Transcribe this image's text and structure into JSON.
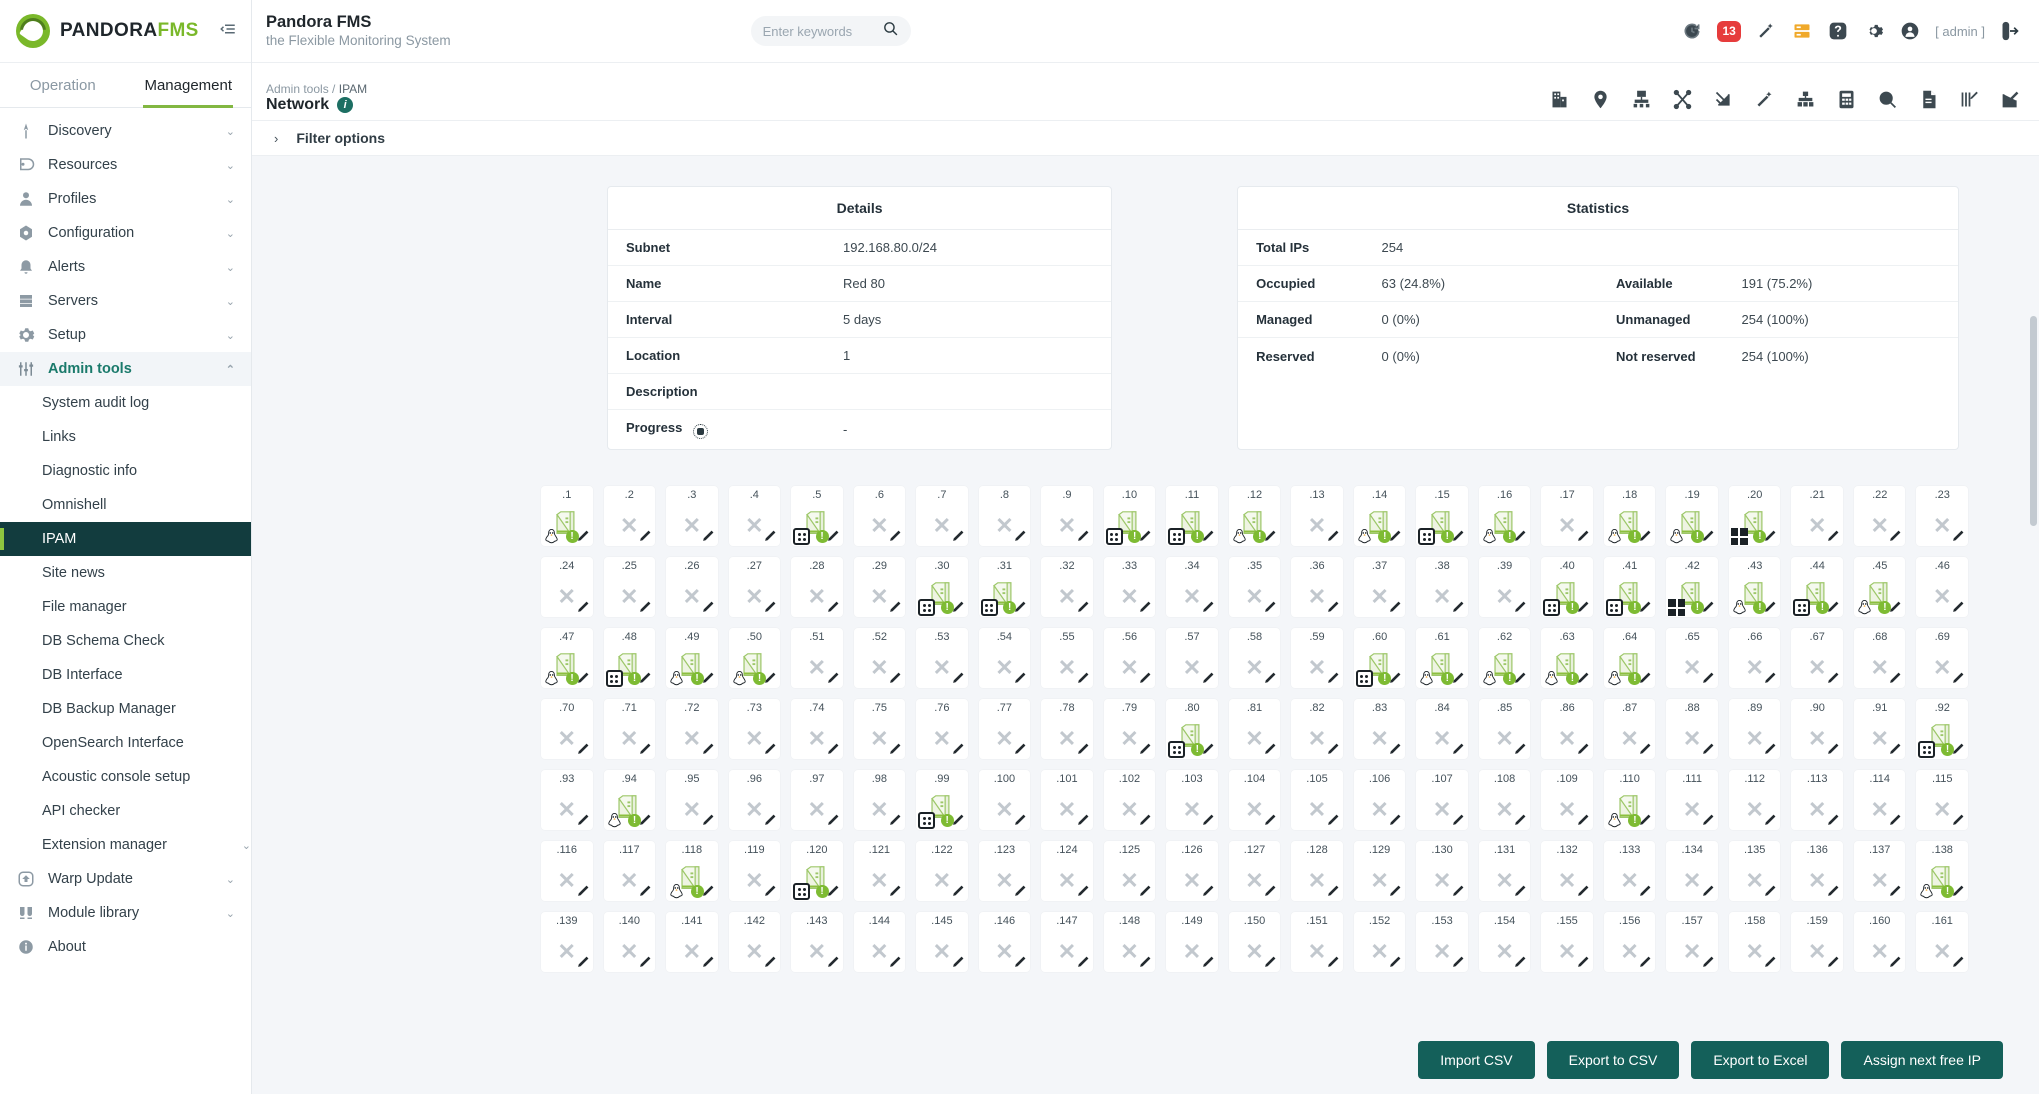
{
  "brand": {
    "name_dark": "PANDORA",
    "name_green": "FMS",
    "collapse_icon": "collapse-icon"
  },
  "tabs": [
    {
      "label": "Operation",
      "active": false
    },
    {
      "label": "Management",
      "active": true
    }
  ],
  "sidebar": {
    "groups": [
      {
        "label": "Discovery",
        "icon": "discovery-icon",
        "chevron": "⌄"
      },
      {
        "label": "Resources",
        "icon": "resources-icon",
        "chevron": "⌄"
      },
      {
        "label": "Profiles",
        "icon": "profiles-icon",
        "chevron": "⌄"
      },
      {
        "label": "Configuration",
        "icon": "configuration-icon",
        "chevron": "⌄"
      },
      {
        "label": "Alerts",
        "icon": "alerts-icon",
        "chevron": "⌄"
      },
      {
        "label": "Servers",
        "icon": "servers-icon",
        "chevron": "⌄"
      },
      {
        "label": "Setup",
        "icon": "setup-icon",
        "chevron": "⌄"
      },
      {
        "label": "Admin tools",
        "icon": "admin-tools-icon",
        "chevron": "⌃",
        "open": true
      }
    ],
    "admin_tools_items": [
      {
        "label": "System audit log",
        "active": false
      },
      {
        "label": "Links",
        "active": false
      },
      {
        "label": "Diagnostic info",
        "active": false
      },
      {
        "label": "Omnishell",
        "active": false
      },
      {
        "label": "IPAM",
        "active": true
      },
      {
        "label": "Site news",
        "active": false
      },
      {
        "label": "File manager",
        "active": false
      },
      {
        "label": "DB Schema Check",
        "active": false
      },
      {
        "label": "DB Interface",
        "active": false
      },
      {
        "label": "DB Backup Manager",
        "active": false
      },
      {
        "label": "OpenSearch Interface",
        "active": false
      },
      {
        "label": "Acoustic console setup",
        "active": false
      },
      {
        "label": "API checker",
        "active": false
      },
      {
        "label": "Extension manager",
        "active": false,
        "chevron": "⌄"
      }
    ],
    "bottom_groups": [
      {
        "label": "Warp Update",
        "icon": "warp-update-icon",
        "chevron": "⌄"
      },
      {
        "label": "Module library",
        "icon": "module-library-icon",
        "chevron": "⌄"
      },
      {
        "label": "About",
        "icon": "about-icon"
      }
    ]
  },
  "header": {
    "title": "Pandora FMS",
    "subtitle": "the Flexible Monitoring System",
    "search_placeholder": "Enter keywords",
    "search_value": "",
    "alert_count": "13",
    "user_label": "[ admin ]",
    "icons": [
      "clock-refresh-icon",
      "alert-badge",
      "wand-icon",
      "servers-status-icon",
      "help-icon",
      "gear-icon",
      "user-avatar-icon",
      "logout-icon"
    ]
  },
  "subheader": {
    "breadcrumb_parent": "Admin tools",
    "breadcrumb_sep": "/",
    "breadcrumb_current": "IPAM",
    "page_title": "Network",
    "info_icon": "info-icon",
    "tool_icons": [
      "building-icon",
      "map-pin-icon",
      "network-map-icon",
      "vlan-icon",
      "supernet-icon",
      "wand-icon",
      "sitemap-icon",
      "calculator-icon",
      "search-icon",
      "report-icon",
      "vlan-wan-icon",
      "edit-icon"
    ]
  },
  "filter": {
    "chevron": "›",
    "label": "Filter options"
  },
  "details": {
    "title": "Details",
    "rows": [
      {
        "key": "Subnet",
        "value": "192.168.80.0/24"
      },
      {
        "key": "Name",
        "value": "Red 80"
      },
      {
        "key": "Interval",
        "value": "5 days"
      },
      {
        "key": "Location",
        "value": "1"
      },
      {
        "key": "Description",
        "value": ""
      },
      {
        "key": "Progress",
        "value": "-",
        "icon": "progress-gear-icon"
      }
    ]
  },
  "statistics": {
    "title": "Statistics",
    "rows": [
      {
        "key": "Total IPs",
        "value": "254",
        "key2": "",
        "value2": ""
      },
      {
        "key": "Occupied",
        "value": "63 (24.8%)",
        "key2": "Available",
        "value2": "191 (75.2%)"
      },
      {
        "key": "Managed",
        "value": "0 (0%)",
        "key2": "Unmanaged",
        "value2": "254 (100%)"
      },
      {
        "key": "Reserved",
        "value": "0 (0%)",
        "key2": "Not reserved",
        "value2": "254 (100%)"
      }
    ]
  },
  "buttons": [
    {
      "label": "Import CSV",
      "name": "import-csv-button"
    },
    {
      "label": "Export to CSV",
      "name": "export-csv-button"
    },
    {
      "label": "Export to Excel",
      "name": "export-excel-button"
    },
    {
      "label": "Assign next free IP",
      "name": "assign-next-free-ip-button"
    }
  ],
  "ip_grid": {
    "columns": 23,
    "cells": [
      {
        "label": ".1",
        "state": "occupied",
        "os": "linux"
      },
      {
        "label": ".2",
        "state": "free"
      },
      {
        "label": ".3",
        "state": "free"
      },
      {
        "label": ".4",
        "state": "free"
      },
      {
        "label": ".5",
        "state": "occupied",
        "os": "box"
      },
      {
        "label": ".6",
        "state": "free"
      },
      {
        "label": ".7",
        "state": "free"
      },
      {
        "label": ".8",
        "state": "free"
      },
      {
        "label": ".9",
        "state": "free"
      },
      {
        "label": ".10",
        "state": "occupied",
        "os": "box"
      },
      {
        "label": ".11",
        "state": "occupied",
        "os": "box"
      },
      {
        "label": ".12",
        "state": "occupied",
        "os": "linux"
      },
      {
        "label": ".13",
        "state": "free"
      },
      {
        "label": ".14",
        "state": "occupied",
        "os": "linux"
      },
      {
        "label": ".15",
        "state": "occupied",
        "os": "box"
      },
      {
        "label": ".16",
        "state": "occupied",
        "os": "linux"
      },
      {
        "label": ".17",
        "state": "free"
      },
      {
        "label": ".18",
        "state": "occupied",
        "os": "linux"
      },
      {
        "label": ".19",
        "state": "occupied",
        "os": "linux"
      },
      {
        "label": ".20",
        "state": "occupied",
        "os": "windows"
      },
      {
        "label": ".21",
        "state": "free"
      },
      {
        "label": ".22",
        "state": "free"
      },
      {
        "label": ".23",
        "state": "free"
      },
      {
        "label": ".24",
        "state": "free"
      },
      {
        "label": ".25",
        "state": "free"
      },
      {
        "label": ".26",
        "state": "free"
      },
      {
        "label": ".27",
        "state": "free"
      },
      {
        "label": ".28",
        "state": "free"
      },
      {
        "label": ".29",
        "state": "free"
      },
      {
        "label": ".30",
        "state": "occupied",
        "os": "box"
      },
      {
        "label": ".31",
        "state": "occupied",
        "os": "box"
      },
      {
        "label": ".32",
        "state": "free"
      },
      {
        "label": ".33",
        "state": "free"
      },
      {
        "label": ".34",
        "state": "free"
      },
      {
        "label": ".35",
        "state": "free"
      },
      {
        "label": ".36",
        "state": "free"
      },
      {
        "label": ".37",
        "state": "free"
      },
      {
        "label": ".38",
        "state": "free"
      },
      {
        "label": ".39",
        "state": "free"
      },
      {
        "label": ".40",
        "state": "occupied",
        "os": "box"
      },
      {
        "label": ".41",
        "state": "occupied",
        "os": "box"
      },
      {
        "label": ".42",
        "state": "occupied",
        "os": "windows"
      },
      {
        "label": ".43",
        "state": "occupied",
        "os": "linux"
      },
      {
        "label": ".44",
        "state": "occupied",
        "os": "box"
      },
      {
        "label": ".45",
        "state": "occupied",
        "os": "linux"
      },
      {
        "label": ".46",
        "state": "free"
      },
      {
        "label": ".47",
        "state": "occupied",
        "os": "linux"
      },
      {
        "label": ".48",
        "state": "occupied",
        "os": "box"
      },
      {
        "label": ".49",
        "state": "occupied",
        "os": "linux"
      },
      {
        "label": ".50",
        "state": "occupied",
        "os": "linux"
      },
      {
        "label": ".51",
        "state": "free"
      },
      {
        "label": ".52",
        "state": "free"
      },
      {
        "label": ".53",
        "state": "free"
      },
      {
        "label": ".54",
        "state": "free"
      },
      {
        "label": ".55",
        "state": "free"
      },
      {
        "label": ".56",
        "state": "free"
      },
      {
        "label": ".57",
        "state": "free"
      },
      {
        "label": ".58",
        "state": "free"
      },
      {
        "label": ".59",
        "state": "free"
      },
      {
        "label": ".60",
        "state": "occupied",
        "os": "box"
      },
      {
        "label": ".61",
        "state": "occupied",
        "os": "linux"
      },
      {
        "label": ".62",
        "state": "occupied",
        "os": "linux"
      },
      {
        "label": ".63",
        "state": "occupied",
        "os": "linux"
      },
      {
        "label": ".64",
        "state": "occupied",
        "os": "linux"
      },
      {
        "label": ".65",
        "state": "free"
      },
      {
        "label": ".66",
        "state": "free"
      },
      {
        "label": ".67",
        "state": "free"
      },
      {
        "label": ".68",
        "state": "free"
      },
      {
        "label": ".69",
        "state": "free"
      },
      {
        "label": ".70",
        "state": "free"
      },
      {
        "label": ".71",
        "state": "free"
      },
      {
        "label": ".72",
        "state": "free"
      },
      {
        "label": ".73",
        "state": "free"
      },
      {
        "label": ".74",
        "state": "free"
      },
      {
        "label": ".75",
        "state": "free"
      },
      {
        "label": ".76",
        "state": "free"
      },
      {
        "label": ".77",
        "state": "free"
      },
      {
        "label": ".78",
        "state": "free"
      },
      {
        "label": ".79",
        "state": "free"
      },
      {
        "label": ".80",
        "state": "occupied",
        "os": "box"
      },
      {
        "label": ".81",
        "state": "free"
      },
      {
        "label": ".82",
        "state": "free"
      },
      {
        "label": ".83",
        "state": "free"
      },
      {
        "label": ".84",
        "state": "free"
      },
      {
        "label": ".85",
        "state": "free"
      },
      {
        "label": ".86",
        "state": "free"
      },
      {
        "label": ".87",
        "state": "free"
      },
      {
        "label": ".88",
        "state": "free"
      },
      {
        "label": ".89",
        "state": "free"
      },
      {
        "label": ".90",
        "state": "free"
      },
      {
        "label": ".91",
        "state": "free"
      },
      {
        "label": ".92",
        "state": "occupied",
        "os": "box"
      },
      {
        "label": ".93",
        "state": "free"
      },
      {
        "label": ".94",
        "state": "occupied",
        "os": "linux"
      },
      {
        "label": ".95",
        "state": "free"
      },
      {
        "label": ".96",
        "state": "free"
      },
      {
        "label": ".97",
        "state": "free"
      },
      {
        "label": ".98",
        "state": "free"
      },
      {
        "label": ".99",
        "state": "occupied",
        "os": "box"
      },
      {
        "label": ".100",
        "state": "free"
      },
      {
        "label": ".101",
        "state": "free"
      },
      {
        "label": ".102",
        "state": "free"
      },
      {
        "label": ".103",
        "state": "free"
      },
      {
        "label": ".104",
        "state": "free"
      },
      {
        "label": ".105",
        "state": "free"
      },
      {
        "label": ".106",
        "state": "free"
      },
      {
        "label": ".107",
        "state": "free"
      },
      {
        "label": ".108",
        "state": "free"
      },
      {
        "label": ".109",
        "state": "free"
      },
      {
        "label": ".110",
        "state": "occupied",
        "os": "linux"
      },
      {
        "label": ".111",
        "state": "free"
      },
      {
        "label": ".112",
        "state": "free"
      },
      {
        "label": ".113",
        "state": "free"
      },
      {
        "label": ".114",
        "state": "free"
      },
      {
        "label": ".115",
        "state": "free"
      },
      {
        "label": ".116",
        "state": "free"
      },
      {
        "label": ".117",
        "state": "free"
      },
      {
        "label": ".118",
        "state": "occupied",
        "os": "linux"
      },
      {
        "label": ".119",
        "state": "free"
      },
      {
        "label": ".120",
        "state": "occupied",
        "os": "box"
      },
      {
        "label": ".121",
        "state": "free"
      },
      {
        "label": ".122",
        "state": "free"
      },
      {
        "label": ".123",
        "state": "free"
      },
      {
        "label": ".124",
        "state": "free"
      },
      {
        "label": ".125",
        "state": "free"
      },
      {
        "label": ".126",
        "state": "free"
      },
      {
        "label": ".127",
        "state": "free"
      },
      {
        "label": ".128",
        "state": "free"
      },
      {
        "label": ".129",
        "state": "free"
      },
      {
        "label": ".130",
        "state": "free"
      },
      {
        "label": ".131",
        "state": "free"
      },
      {
        "label": ".132",
        "state": "free"
      },
      {
        "label": ".133",
        "state": "free"
      },
      {
        "label": ".134",
        "state": "free"
      },
      {
        "label": ".135",
        "state": "free"
      },
      {
        "label": ".136",
        "state": "free"
      },
      {
        "label": ".137",
        "state": "free"
      },
      {
        "label": ".138",
        "state": "occupied",
        "os": "linux"
      },
      {
        "label": ".139",
        "state": "free"
      },
      {
        "label": ".140",
        "state": "free"
      },
      {
        "label": ".141",
        "state": "free"
      },
      {
        "label": ".142",
        "state": "free"
      },
      {
        "label": ".143",
        "state": "free"
      },
      {
        "label": ".144",
        "state": "free"
      },
      {
        "label": ".145",
        "state": "free"
      },
      {
        "label": ".146",
        "state": "free"
      },
      {
        "label": ".147",
        "state": "free"
      },
      {
        "label": ".148",
        "state": "free"
      },
      {
        "label": ".149",
        "state": "free"
      },
      {
        "label": ".150",
        "state": "free"
      },
      {
        "label": ".151",
        "state": "free"
      },
      {
        "label": ".152",
        "state": "free"
      },
      {
        "label": ".153",
        "state": "free"
      },
      {
        "label": ".154",
        "state": "free"
      },
      {
        "label": ".155",
        "state": "free"
      },
      {
        "label": ".156",
        "state": "free"
      },
      {
        "label": ".157",
        "state": "free"
      },
      {
        "label": ".158",
        "state": "free"
      },
      {
        "label": ".159",
        "state": "free"
      },
      {
        "label": ".160",
        "state": "free"
      },
      {
        "label": ".161",
        "state": "free"
      }
    ]
  }
}
